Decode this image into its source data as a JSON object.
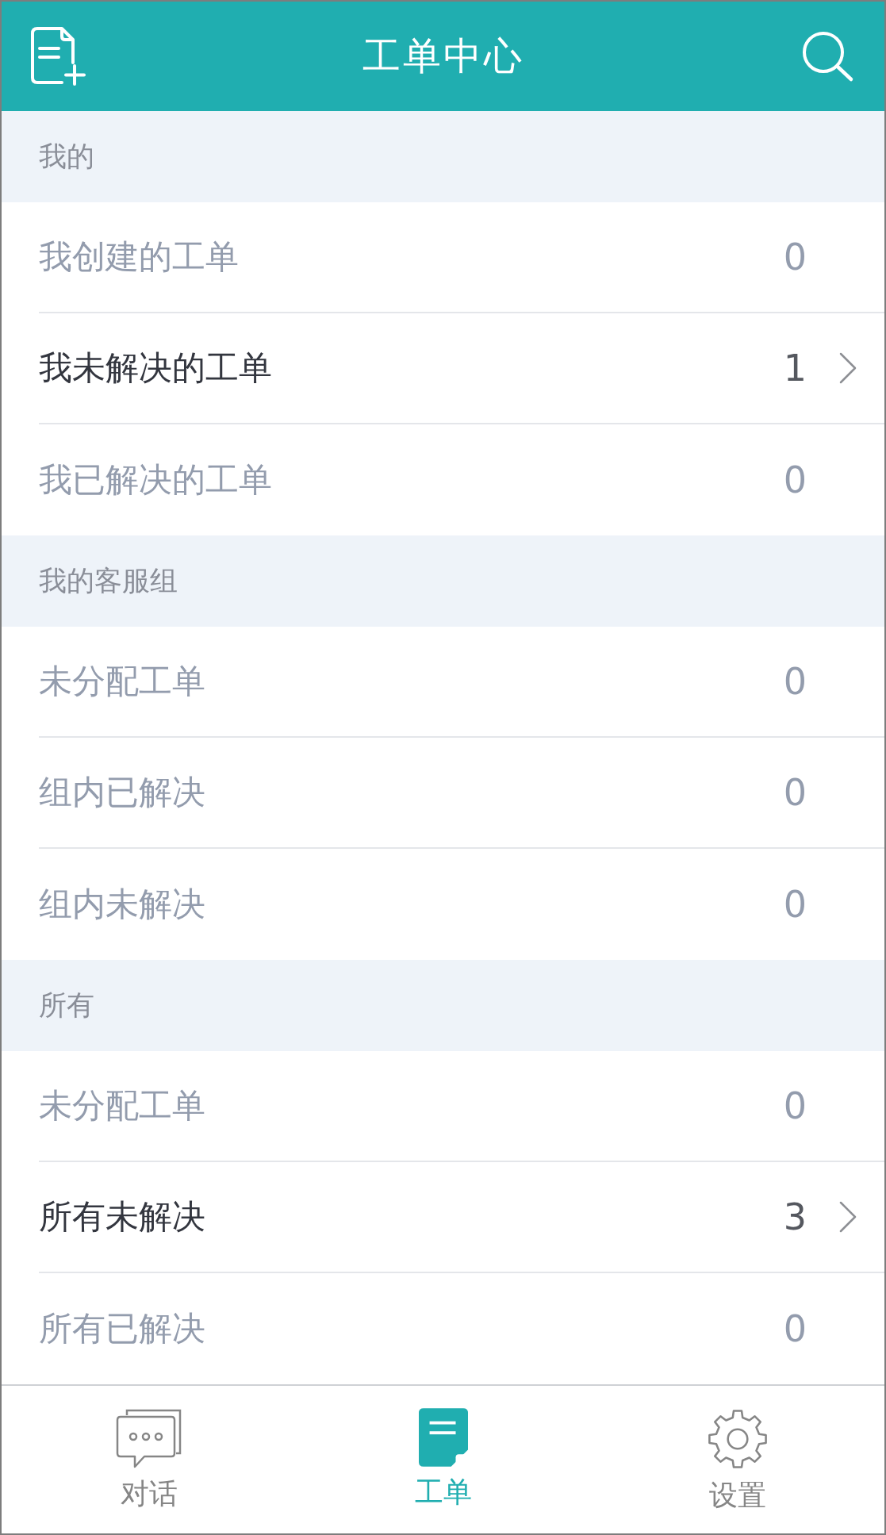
{
  "header": {
    "title": "工单中心"
  },
  "sections": [
    {
      "title": "我的",
      "rows": [
        {
          "label": "我创建的工单",
          "count": "0",
          "disabled": true
        },
        {
          "label": "我未解决的工单",
          "count": "1",
          "disabled": false
        },
        {
          "label": "我已解决的工单",
          "count": "0",
          "disabled": true
        }
      ]
    },
    {
      "title": "我的客服组",
      "rows": [
        {
          "label": "未分配工单",
          "count": "0",
          "disabled": true
        },
        {
          "label": "组内已解决",
          "count": "0",
          "disabled": true
        },
        {
          "label": "组内未解决",
          "count": "0",
          "disabled": true
        }
      ]
    },
    {
      "title": "所有",
      "rows": [
        {
          "label": "未分配工单",
          "count": "0",
          "disabled": true
        },
        {
          "label": "所有未解决",
          "count": "3",
          "disabled": false
        },
        {
          "label": "所有已解决",
          "count": "0",
          "disabled": true
        }
      ]
    }
  ],
  "tabs": [
    {
      "label": "对话",
      "kind": "chat",
      "selected": false
    },
    {
      "label": "工单",
      "kind": "ticket",
      "selected": true
    },
    {
      "label": "设置",
      "kind": "settings",
      "selected": false
    }
  ]
}
